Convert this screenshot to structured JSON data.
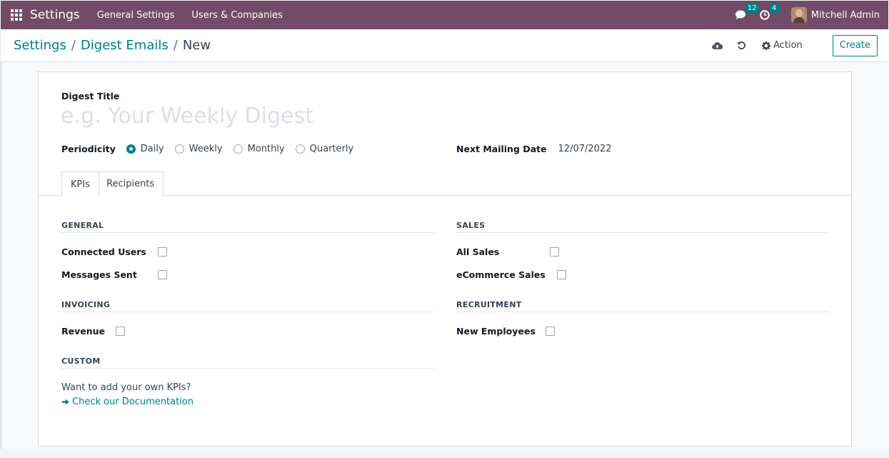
{
  "navbar": {
    "brand": "Settings",
    "menus": [
      "General Settings",
      "Users & Companies"
    ],
    "messages_count": "12",
    "activities_count": "4",
    "user_name": "Mitchell Admin"
  },
  "breadcrumb": {
    "root": "Settings",
    "parent": "Digest Emails",
    "current": "New",
    "separator": "/"
  },
  "toolbar": {
    "action_label": "Action",
    "create_label": "Create"
  },
  "form": {
    "title_label": "Digest Title",
    "title_placeholder": "e.g. Your Weekly Digest",
    "periodicity_label": "Periodicity",
    "periodicity_options": [
      "Daily",
      "Weekly",
      "Monthly",
      "Quarterly"
    ],
    "periodicity_selected": "Daily",
    "next_mailing_label": "Next Mailing Date",
    "next_mailing_value": "12/07/2022"
  },
  "tabs": [
    "KPIs",
    "Recipients"
  ],
  "kpis": {
    "general": {
      "heading": "GENERAL",
      "items": [
        "Connected Users",
        "Messages Sent"
      ]
    },
    "sales": {
      "heading": "SALES",
      "items": [
        "All Sales",
        "eCommerce Sales"
      ]
    },
    "invoicing": {
      "heading": "INVOICING",
      "items": [
        "Revenue"
      ]
    },
    "recruitment": {
      "heading": "RECRUITMENT",
      "items": [
        "New Employees"
      ]
    },
    "custom": {
      "heading": "CUSTOM",
      "text": "Want to add your own KPIs?",
      "link": "Check our Documentation"
    }
  },
  "colors": {
    "navbar": "#714b67",
    "accent": "#017e84"
  }
}
